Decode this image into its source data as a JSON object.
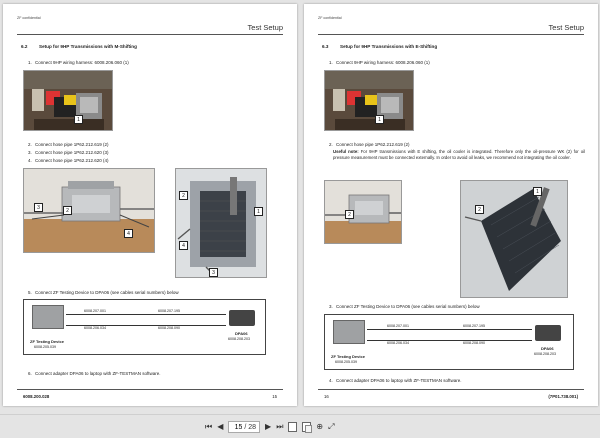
{
  "confidential_label": "ZF confidential",
  "header_title": "Test Setup",
  "left_page": {
    "section_number": "6.2",
    "section_title": "Setup for 9HP Transmissions with M-Shifting",
    "steps": [
      {
        "num": "1.",
        "text": "Connect 9HP wiring harness: 6008.206.060 (1)"
      },
      {
        "num": "2.",
        "text": "Connect hose pipe 1P62.212.619 (2)"
      },
      {
        "num": "3.",
        "text": "Connect hose pipe 1P62.212.620 (3)"
      },
      {
        "num": "4.",
        "text": "Connect hose pipe 1P62.212.620 (4)"
      },
      {
        "num": "5.",
        "text": "Connect ZF Testing Device to DPA06 (see cables serial numbers) below"
      },
      {
        "num": "6.",
        "text": "Connect adapter DPA06 to laptop with ZF-TESTMAN software."
      }
    ],
    "photo1_callouts": [
      "1"
    ],
    "photo2_callouts": [
      "3",
      "2",
      "4"
    ],
    "photo3_callouts": [
      "2",
      "1",
      "4",
      "3"
    ],
    "diagram": {
      "device_label": "ZF Testing Device",
      "device_number": "6008.205.039",
      "adapter_label": "DPA06",
      "adapter_number": "6008.208.203",
      "cable_top_left": "6008.207.001",
      "cable_top_right": "6008.207.195",
      "cable_bottom_left": "6008.206.034",
      "cable_bottom_right": "6008.208.090"
    },
    "footer_left": "6008.200.028",
    "footer_right": "15"
  },
  "right_page": {
    "section_number": "6.3",
    "section_title": "Setup for 9HP Transmissions with E-Shifting",
    "steps": [
      {
        "num": "1.",
        "text": "Connect 9HP wiring harness: 6008.206.060 (1)"
      },
      {
        "num": "2.",
        "text": "Connect hose pipe 1P62.212.619 (2)"
      },
      {
        "num": "3.",
        "text": "Connect ZF Testing Device to DPA06 (see cables serial numbers) below"
      },
      {
        "num": "4.",
        "text": "Connect adapter DPA06 to laptop with ZF-TESTMAN software."
      }
    ],
    "useful_note_label": "Useful note:",
    "useful_note_text": "For 9HP transmissions with E shifting, the oil cooler is integrated. Therefore only the oil-pressure WK (2) for oil pressure measurement must be connected externally. In order to avoid oil leaks, we recommend not integrating the oil cooler.",
    "photo1_callouts": [
      "1"
    ],
    "photo2_callouts": [
      "2"
    ],
    "photo3_callouts": [
      "1",
      "2"
    ],
    "diagram": {
      "device_label": "ZF Testing Device",
      "device_number": "6008.205.039",
      "adapter_label": "DPA06",
      "adapter_number": "6008.208.203",
      "cable_top_left": "6008.207.001",
      "cable_top_right": "6008.207.195",
      "cable_bottom_left": "6008.206.034",
      "cable_bottom_right": "6008.208.090"
    },
    "footer_left": "16",
    "footer_right": "(7P01.738.001)"
  },
  "toolbar": {
    "first_page": "⏮",
    "prev_page": "◀",
    "current_page": "15",
    "total_pages": "/ 28",
    "next_page": "▶",
    "last_page": "⏭",
    "icons": [
      "single-page-icon",
      "two-page-icon",
      "zoom-icon",
      "fit-icon"
    ]
  }
}
